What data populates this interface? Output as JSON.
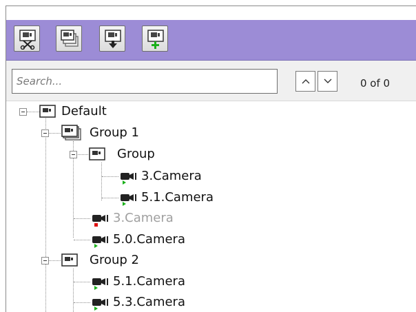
{
  "toolbar": {
    "buttons": [
      {
        "icon": "cut-monitor-icon"
      },
      {
        "icon": "copy-monitor-icon"
      },
      {
        "icon": "move-down-monitor-icon"
      },
      {
        "icon": "add-monitor-icon"
      }
    ]
  },
  "search": {
    "placeholder": "Search...",
    "value": "",
    "counter": "0 of 0"
  },
  "tree": [
    {
      "label": "Default",
      "type": "monitor",
      "level": 0
    },
    {
      "label": "Group 1",
      "type": "group",
      "level": 1
    },
    {
      "label": "Group",
      "type": "monitor",
      "level": 2
    },
    {
      "label": "3.Camera",
      "type": "camera",
      "level": 3,
      "status": "green"
    },
    {
      "label": "5.1.Camera",
      "type": "camera",
      "level": 3,
      "status": "green"
    },
    {
      "label": "3.Camera",
      "type": "camera",
      "level": 2,
      "status": "red",
      "disabled": true
    },
    {
      "label": "5.0.Camera",
      "type": "camera",
      "level": 2,
      "status": "green"
    },
    {
      "label": "Group 2",
      "type": "monitor",
      "level": 1
    },
    {
      "label": "5.1.Camera",
      "type": "camera",
      "level": 2,
      "status": "green"
    },
    {
      "label": "5.3.Camera",
      "type": "camera",
      "level": 2,
      "status": "green"
    }
  ],
  "colors": {
    "toolbar_bg": "#9c8cd6",
    "status_green": "#1ab01a",
    "status_red": "#e01010",
    "disabled_text": "#a0a0a0"
  }
}
